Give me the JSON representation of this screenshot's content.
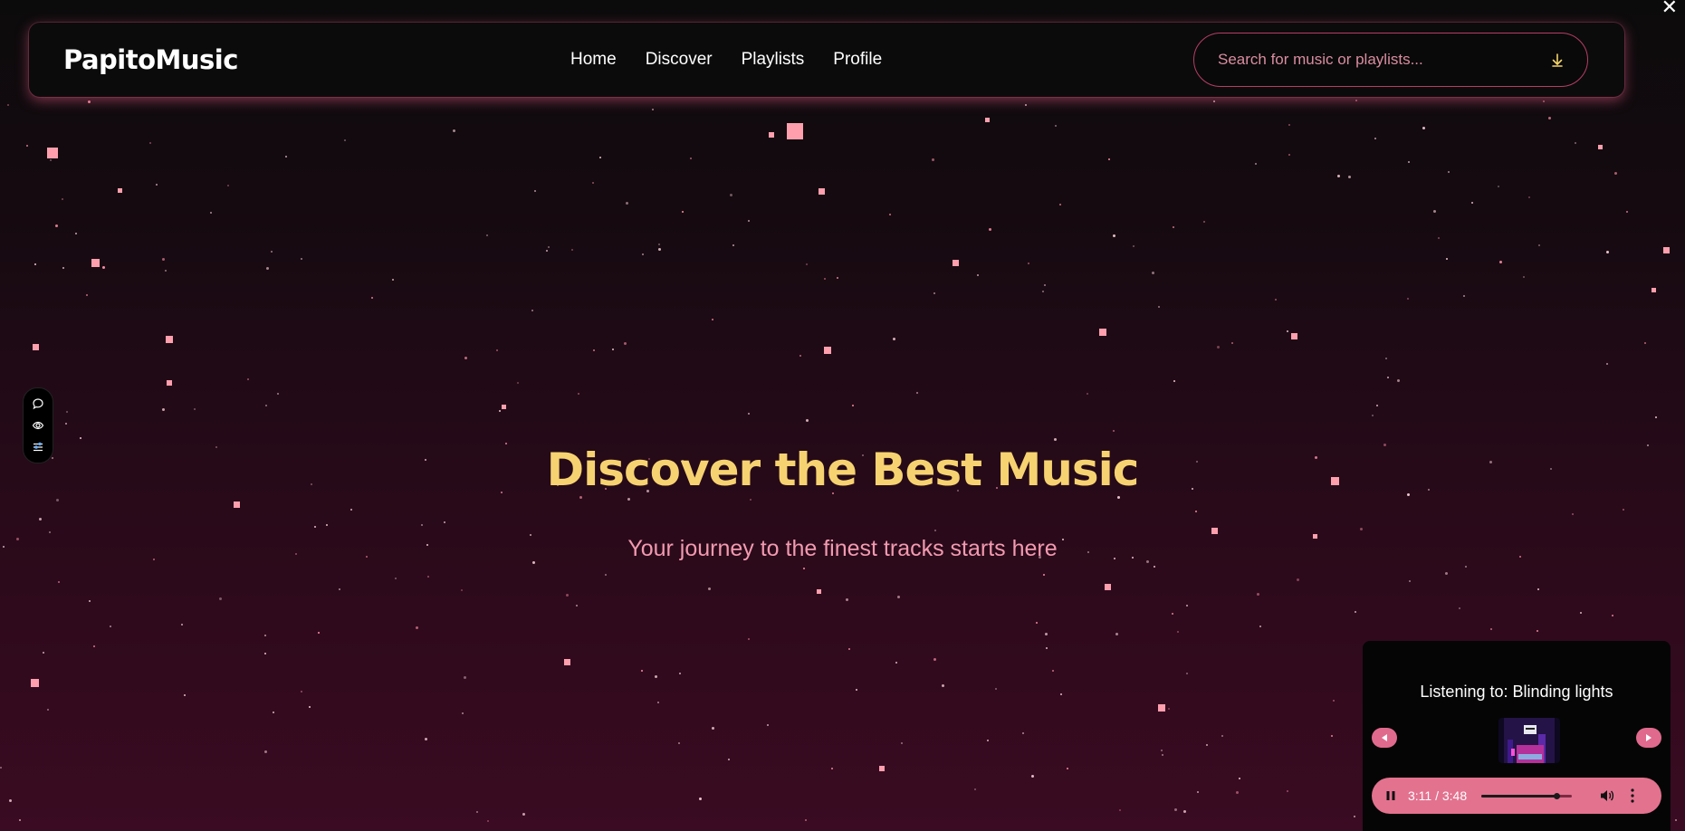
{
  "window": {
    "close_glyph": "✕"
  },
  "navbar": {
    "brand": "PapitoMusic",
    "links": [
      "Home",
      "Discover",
      "Playlists",
      "Profile"
    ],
    "search_placeholder": "Search for music or playlists...",
    "search_icon": "download-arrow-icon"
  },
  "side_widget": {
    "icons": [
      "comment-icon",
      "eye-icon",
      "sliders-icon"
    ]
  },
  "hero": {
    "title": "Discover the Best Music",
    "subtitle": "Your journey to the finest tracks starts here"
  },
  "player": {
    "title": "Listening to: Blinding lights",
    "time": "3:11 / 3:48",
    "progress_fraction": 0.84,
    "prev_icon": "chevron-left-icon",
    "next_icon": "chevron-right-icon"
  },
  "colors": {
    "accent_yellow": "#f7d271",
    "accent_pink": "#f29ab0",
    "player_bar": "#e3728f",
    "star": "#ff9fae"
  }
}
